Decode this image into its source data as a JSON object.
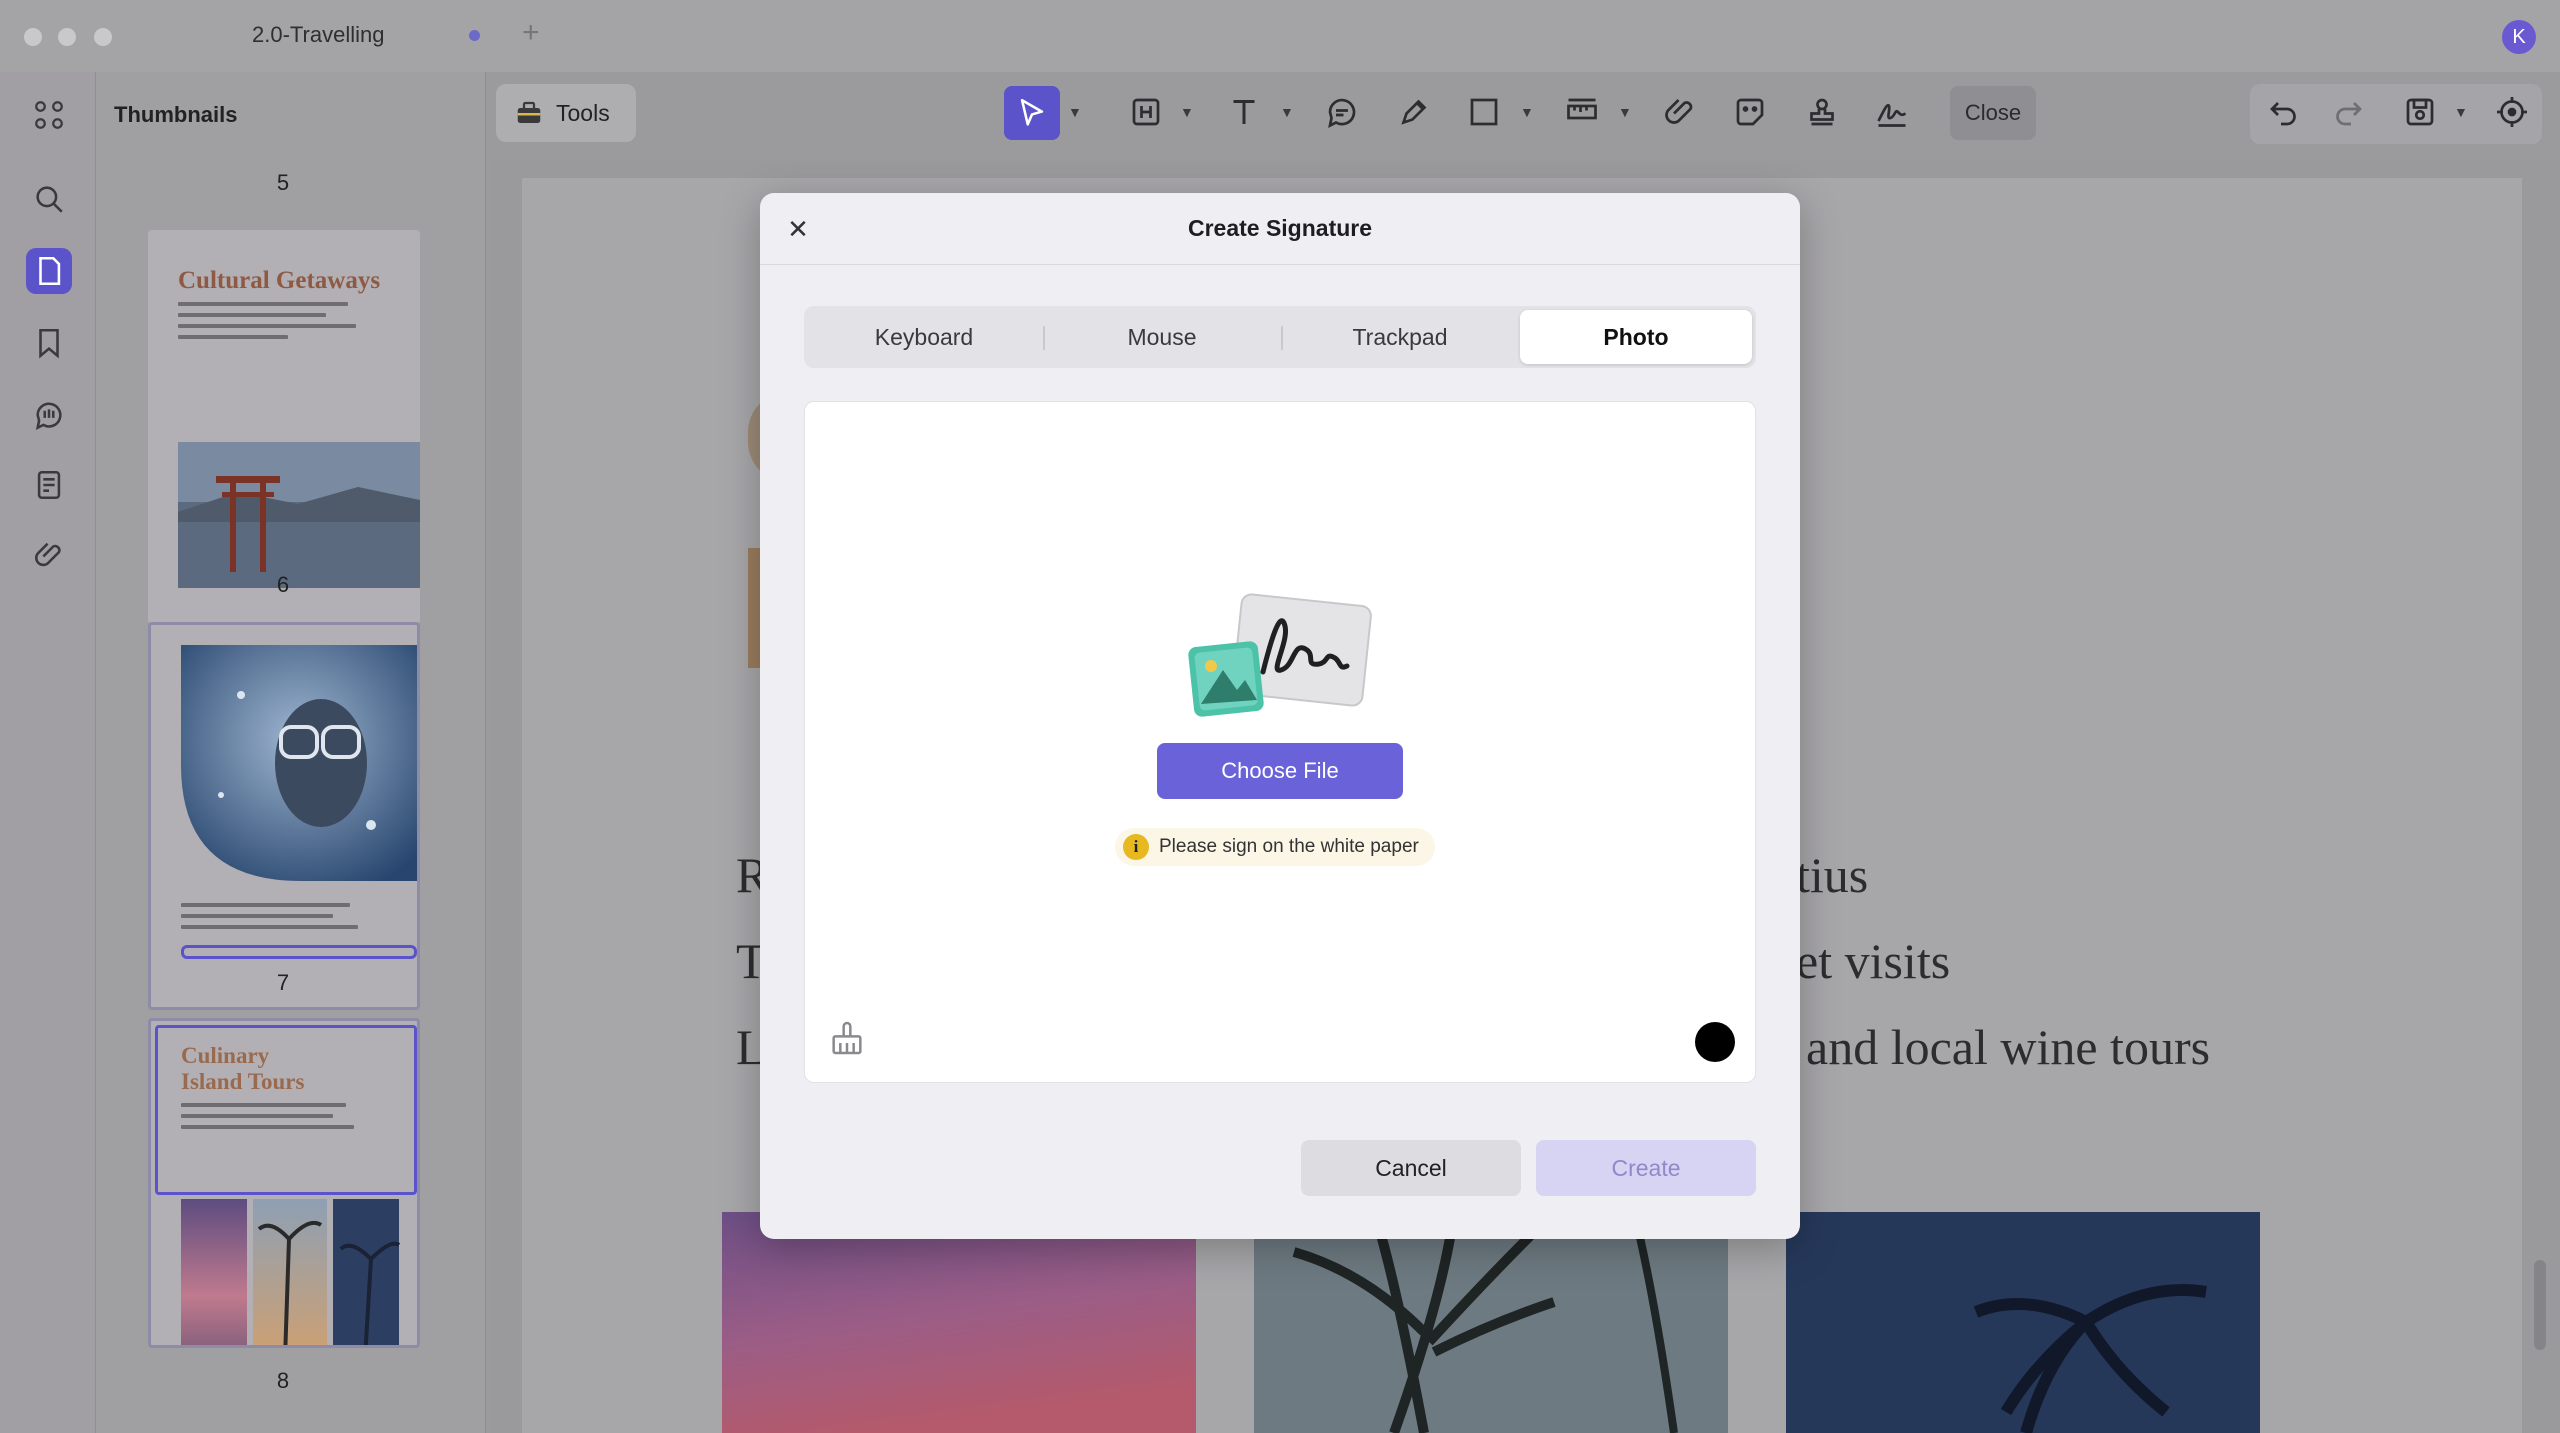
{
  "window": {
    "tab_title": "2.0-Travelling",
    "avatar_initial": "K"
  },
  "toolbar": {
    "tools_label": "Tools",
    "close_label": "Close"
  },
  "sidebar": {
    "title": "Thumbnails",
    "pages": [
      {
        "number": "5"
      },
      {
        "number": "6",
        "heading": "Cultural Getaways"
      },
      {
        "number": "7"
      },
      {
        "number": "8",
        "heading_line1": "Culinary",
        "heading_line2": "Island Tours"
      }
    ]
  },
  "document": {
    "visible_text": [
      "R",
      "T",
      "L",
      "tius",
      "et visits",
      "and local wine tours"
    ]
  },
  "dialog": {
    "title": "Create Signature",
    "tabs": [
      "Keyboard",
      "Mouse",
      "Trackpad",
      "Photo"
    ],
    "active_tab": "Photo",
    "choose_file_label": "Choose File",
    "hint": "Please sign on the white paper",
    "hint_icon": "i",
    "cancel_label": "Cancel",
    "create_label": "Create",
    "ink_color": "#000000"
  },
  "colors": {
    "accent": "#6a62d8",
    "accent_disabled": "#d6d3f3"
  }
}
